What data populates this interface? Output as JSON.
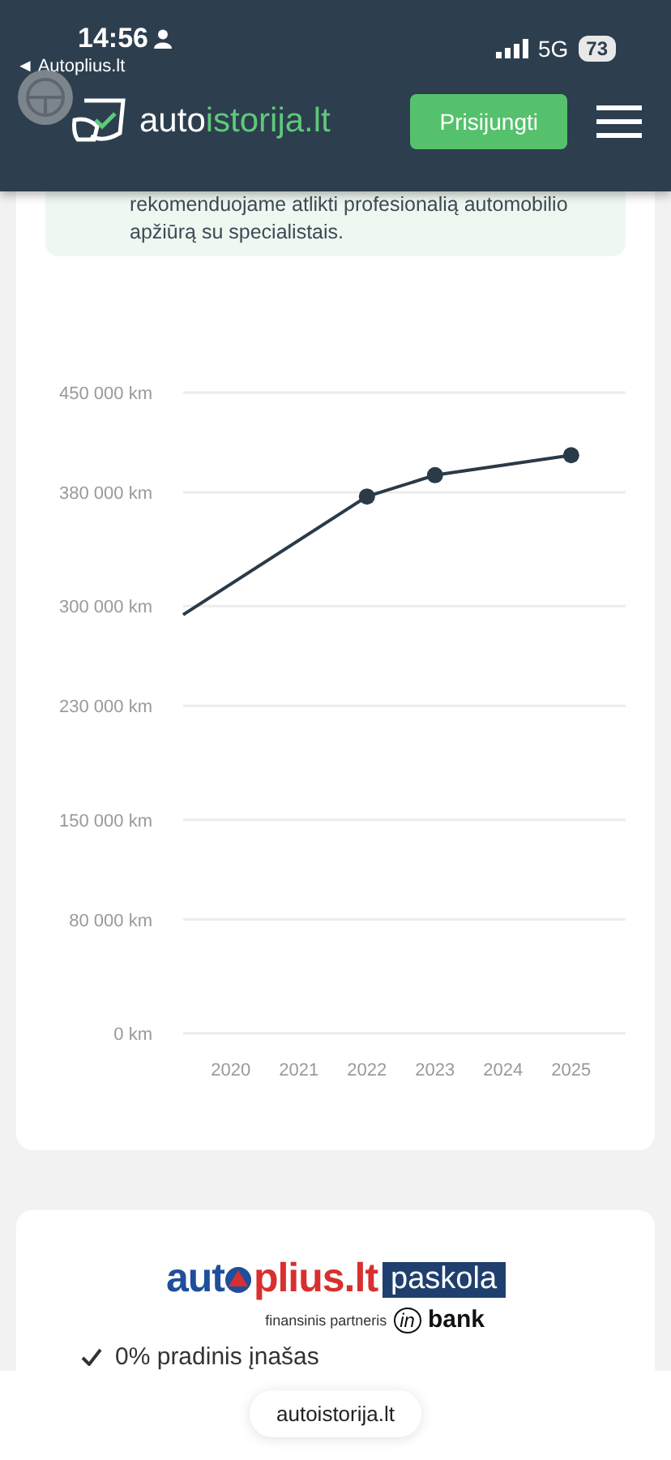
{
  "status_bar": {
    "time": "14:56",
    "back_link": "◄ Autoplius.lt",
    "network": "5G",
    "battery": "73"
  },
  "header": {
    "logo_first": "auto",
    "logo_second": "istorija.lt",
    "login_button": "Prisijungti"
  },
  "notice": {
    "text": "rekomenduojame atlikti profesionalią automobilio apžiūrą su specialistais."
  },
  "mileage_card": {
    "chart_data": {
      "type": "line",
      "x": [
        2019.3,
        2022,
        2023,
        2025
      ],
      "grid": true,
      "series": [
        {
          "color": "#2b3a48",
          "values": [
            294000,
            377000,
            392000,
            406000
          ]
        }
      ],
      "xlim": [
        2019.3,
        2025.8
      ],
      "ylim": [
        0,
        450000
      ],
      "xticks": [
        2020,
        2021,
        2022,
        2023,
        2024,
        2025
      ],
      "yticks": [
        {
          "value": 0,
          "label": "0 km"
        },
        {
          "value": 80000,
          "label": "80 000 km"
        },
        {
          "value": 150000,
          "label": "150 000 km"
        },
        {
          "value": 230000,
          "label": "230 000 km"
        },
        {
          "value": 300000,
          "label": "300 000 km"
        },
        {
          "value": 380000,
          "label": "380 000 km"
        },
        {
          "value": 450000,
          "label": "450 000 km"
        }
      ]
    }
  },
  "loan_card": {
    "brand_first": "aut",
    "brand_second": "plius.lt",
    "product": "paskola",
    "partner_label": "finansinis partneris",
    "bank_first": "in",
    "bank_second": "bank",
    "features": [
      "0% pradinis įnašas"
    ]
  },
  "browser_bar": {
    "url": "autoistorija.lt"
  }
}
